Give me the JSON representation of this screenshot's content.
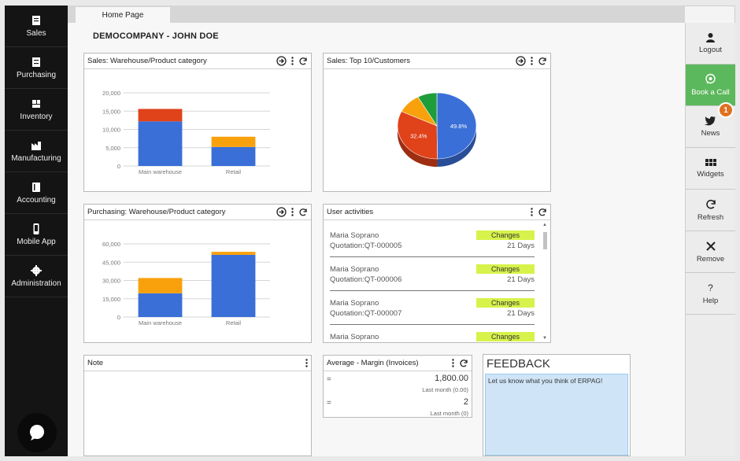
{
  "nav": [
    {
      "label": "Sales",
      "icon": "sales-icon"
    },
    {
      "label": "Purchasing",
      "icon": "purchasing-icon"
    },
    {
      "label": "Inventory",
      "icon": "inventory-icon"
    },
    {
      "label": "Manufacturing",
      "icon": "manufacturing-icon"
    },
    {
      "label": "Accounting",
      "icon": "accounting-icon"
    },
    {
      "label": "Mobile App",
      "icon": "mobile-icon"
    },
    {
      "label": "Administration",
      "icon": "gear-icon"
    }
  ],
  "tab": {
    "label": "Home Page"
  },
  "company": "DEMOCOMPANY - JOHN DOE",
  "colors": {
    "blue": "#3a6fd8",
    "red": "#e0421a",
    "orange": "#f8a10c",
    "green": "#1e9e3a",
    "accent_green": "#5cb85c",
    "badge": "#e07020",
    "change_tag": "#d7f24a"
  },
  "widgets": {
    "sales_wh": {
      "title": "Sales: Warehouse/Product category"
    },
    "sales_top": {
      "title": "Sales: Top 10/Customers"
    },
    "purch_wh": {
      "title": "Purchasing: Warehouse/Product category"
    },
    "activities": {
      "title": "User activities"
    },
    "note": {
      "title": "Note"
    },
    "margin": {
      "title": "Average - Margin (Invoices)"
    }
  },
  "chart_data": [
    {
      "type": "bar",
      "stacked": true,
      "categories": [
        "Main warehouse",
        "Retail"
      ],
      "yticks": [
        "0",
        "5,000",
        "10,000",
        "15,000",
        "20,000"
      ],
      "ylim": [
        0,
        20000
      ],
      "series": [
        {
          "color": "#3a6fd8",
          "values": [
            12200,
            5200
          ]
        },
        {
          "color": "#f8a10c",
          "values": [
            0,
            600
          ]
        },
        {
          "color": "#e0421a",
          "values": [
            3400,
            0
          ]
        },
        {
          "color": "#f8a10c",
          "values": [
            0,
            2200
          ]
        }
      ]
    },
    {
      "type": "pie",
      "slices": [
        {
          "value": 49.8,
          "label": "49.8%",
          "color": "#3a6fd8"
        },
        {
          "value": 32.4,
          "label": "32.4%",
          "color": "#e0421a"
        },
        {
          "value": 9.8,
          "label": "",
          "color": "#f8a10c"
        },
        {
          "value": 8.0,
          "label": "",
          "color": "#1e9e3a"
        }
      ]
    },
    {
      "type": "bar",
      "stacked": true,
      "categories": [
        "Main warehouse",
        "Retail"
      ],
      "yticks": [
        "0",
        "15,000",
        "30,000",
        "45,000",
        "60,000"
      ],
      "ylim": [
        0,
        60000
      ],
      "series": [
        {
          "color": "#3a6fd8",
          "values": [
            19500,
            51000
          ]
        },
        {
          "color": "#f8a10c",
          "values": [
            12500,
            2500
          ]
        }
      ]
    }
  ],
  "activities": [
    {
      "user": "Maria Soprano",
      "doc": "Quotation:QT-000005",
      "action": "Changes",
      "age": "21 Days"
    },
    {
      "user": "Maria Soprano",
      "doc": "Quotation:QT-000006",
      "action": "Changes",
      "age": "21 Days"
    },
    {
      "user": "Maria Soprano",
      "doc": "Quotation:QT-000007",
      "action": "Changes",
      "age": "21 Days"
    },
    {
      "user": "Maria Soprano",
      "doc": "",
      "action": "Changes",
      "age": ""
    }
  ],
  "margin": [
    {
      "eq": "=",
      "value": "1,800.00",
      "sub": "Last month (0.00)"
    },
    {
      "eq": "=",
      "value": "2",
      "sub": "Last month (0)"
    }
  ],
  "feedback": {
    "title": "FEEDBACK",
    "text": "Let us know what you think of ERPAG!"
  },
  "rightbar": [
    {
      "label": "Logout",
      "icon": "user-icon"
    },
    {
      "label": "Book a Call",
      "icon": "whatsapp-icon"
    },
    {
      "label": "News",
      "icon": "twitter-icon",
      "badge": "1"
    },
    {
      "label": "Widgets",
      "icon": "widgets-icon"
    },
    {
      "label": "Refresh",
      "icon": "refresh-icon"
    },
    {
      "label": "Remove",
      "icon": "remove-icon"
    },
    {
      "label": "Help",
      "icon": "help-icon"
    }
  ]
}
